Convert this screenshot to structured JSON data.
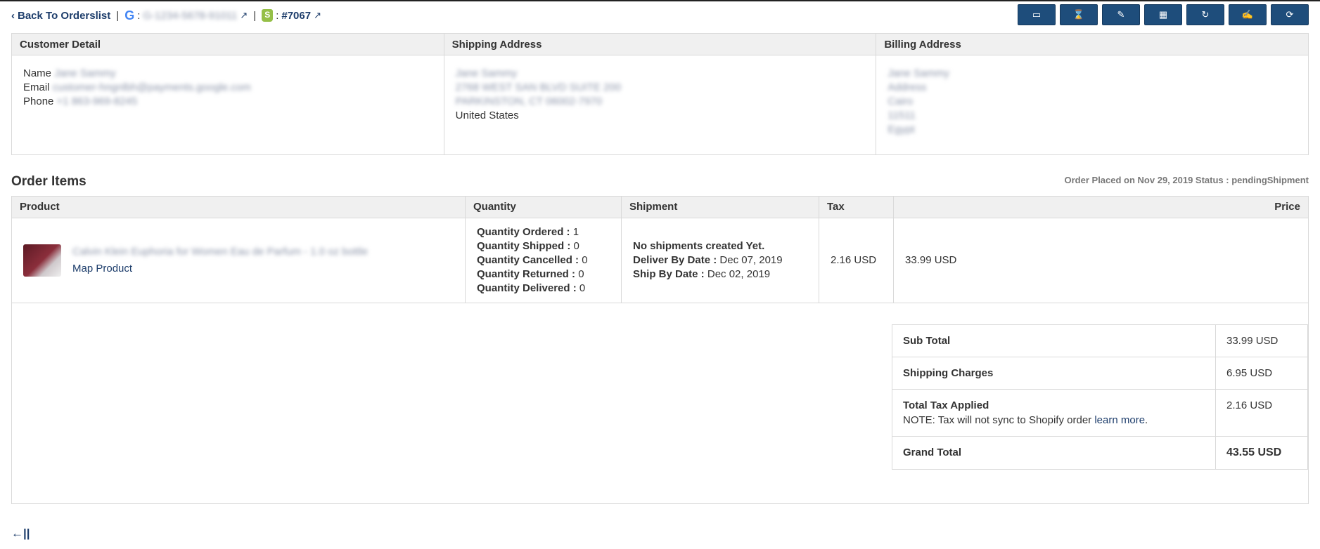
{
  "topbar": {
    "back_label": "Back To Orderslist",
    "google_colon": ":",
    "google_order_id": "G-1234-5678-91011",
    "shopify_colon": ":",
    "shopify_order": "#7067"
  },
  "customer": {
    "header": "Customer Detail",
    "name_label": "Name",
    "name_value": "Jane Sammy",
    "email_label": "Email",
    "email_value": "customer-hngnlbh@payments.google.com",
    "phone_label": "Phone",
    "phone_value": "+1 863-969-8245"
  },
  "shipping": {
    "header": "Shipping Address",
    "line1": "Jane Sammy",
    "line2": "2768 WEST SAN BLVD SUITE 200",
    "line3": "PARKINSTON, CT 06002-7970",
    "country": "United States"
  },
  "billing": {
    "header": "Billing Address",
    "line1": "Jane Sammy",
    "line2": "Address",
    "line3": "Cairo",
    "line4": "11511",
    "line5": "Egypt"
  },
  "items_section": {
    "title": "Order Items",
    "order_meta": "Order Placed on Nov 29, 2019   Status : pendingShipment",
    "columns": [
      "Product",
      "Quantity",
      "Shipment",
      "Tax",
      "Price"
    ]
  },
  "item": {
    "product_name": "Calvin Klein Euphoria for Women Eau de Parfum - 1.0 oz bottle",
    "map_product": "Map Product",
    "qty_ordered_label": "Quantity Ordered :",
    "qty_ordered": "1",
    "qty_shipped_label": "Quantity Shipped :",
    "qty_shipped": "0",
    "qty_cancelled_label": "Quantity Cancelled :",
    "qty_cancelled": "0",
    "qty_returned_label": "Quantity Returned :",
    "qty_returned": "0",
    "qty_delivered_label": "Quantity Delivered :",
    "qty_delivered": "0",
    "shipment_status": "No shipments created Yet.",
    "deliver_label": "Deliver By Date :",
    "deliver_date": "Dec 07, 2019",
    "ship_label": "Ship By Date :",
    "ship_date": "Dec 02, 2019",
    "tax": "2.16 USD",
    "price": "33.99 USD"
  },
  "totals": {
    "subtotal_label": "Sub Total",
    "subtotal": "33.99 USD",
    "shipping_label": "Shipping Charges",
    "shipping": "6.95 USD",
    "tax_label": "Total Tax Applied",
    "tax_note": "NOTE: Tax will not sync to Shopify order",
    "learn_more": "learn more",
    "tax": "2.16 USD",
    "grand_label": "Grand Total",
    "grand": "43.55 USD"
  },
  "toolbar_icons": [
    "card-icon",
    "hourglass-icon",
    "pencil-icon",
    "calendar-icon",
    "refresh-icon",
    "edit-icon",
    "sync-icon"
  ]
}
